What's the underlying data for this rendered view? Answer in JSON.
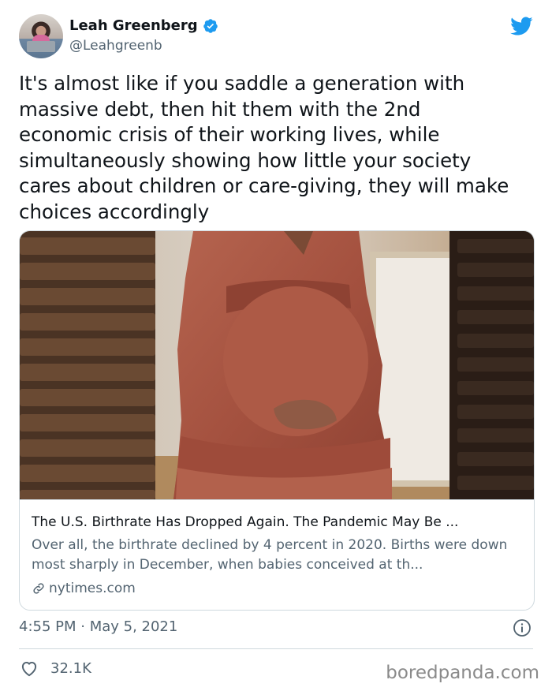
{
  "author": {
    "name": "Leah Greenberg",
    "handle": "@Leahgreenb",
    "verified": true
  },
  "tweet": {
    "text": "It's almost like if you saddle a generation with\nmassive debt, then hit them with the 2nd\neconomic crisis of their working lives, while\nsimultaneously showing how little your society\ncares about children or care-giving, they will make\nchoices accordingly"
  },
  "card": {
    "title": "The U.S. Birthrate Has Dropped Again. The Pandemic May Be ...",
    "description": "Over all, the birthrate declined by 4 percent in 2020. Births were down most sharply in December, when babies conceived at th...",
    "domain": "nytimes.com"
  },
  "meta": {
    "timestamp": "4:55 PM · May 5, 2021",
    "likes": "32.1K"
  },
  "watermark": "boredpanda.com",
  "colors": {
    "twitter_blue": "#1d9bf0",
    "text": "#0f1419",
    "secondary": "#536471",
    "border": "#cfd9de"
  },
  "icons": [
    "verified-badge-icon",
    "twitter-bird-icon",
    "link-icon",
    "info-icon",
    "heart-icon"
  ]
}
